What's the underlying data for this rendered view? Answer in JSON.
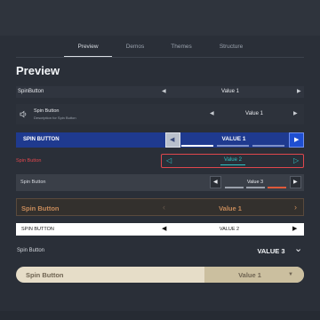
{
  "tabs": [
    {
      "label": "Preview"
    },
    {
      "label": "Demos"
    },
    {
      "label": "Themes"
    },
    {
      "label": "Structure"
    }
  ],
  "page_title": "Preview",
  "rows": {
    "r1": {
      "label": "SpinButton",
      "value": "Value 1",
      "prev": "◀",
      "next": "▶"
    },
    "r2": {
      "label": "Spin Button",
      "description": "Description for Spin Button",
      "value": "Value 1",
      "prev": "◀",
      "next": "▶",
      "icon": "speaker-icon"
    },
    "r3": {
      "label": "SPIN BUTTON",
      "value": "VALUE 1",
      "prev": "◀",
      "next": "▶",
      "accent": "#1f4fd1"
    },
    "r4": {
      "label": "Spin Button",
      "value": "Value 2",
      "prev": "◁",
      "next": "▷",
      "accent": "#e0474c",
      "highlight": "#2ec4c4"
    },
    "r5": {
      "label": "Spin Button",
      "value": "Value 3",
      "prev": "◀",
      "next": "▶",
      "accent": "#e05a3a"
    },
    "r6": {
      "label": "Spin Button",
      "value": "Value 1",
      "prev": "‹",
      "next": "›",
      "accent": "#c68a5a"
    },
    "r7": {
      "label": "SPIN BUTTON",
      "value": "VALUE 2",
      "prev": "◀",
      "next": "▶"
    },
    "r8": {
      "label": "Spin Button",
      "value": "VALUE 3",
      "next": "⌄"
    },
    "r9": {
      "label": "Spin Button",
      "value": "Value 1",
      "next": "▼"
    }
  }
}
